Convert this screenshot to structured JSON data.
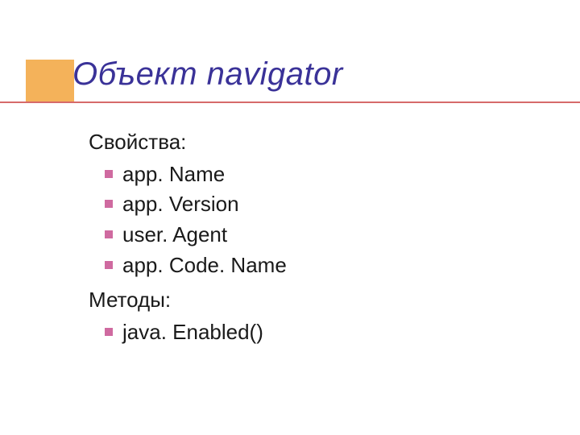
{
  "title": "Объект navigator",
  "sections": {
    "properties": {
      "label": "Свойства:",
      "items": [
        "app. Name",
        "app. Version",
        "user. Agent",
        "app. Code. Name"
      ]
    },
    "methods": {
      "label": "Методы:",
      "items": [
        "java. Enabled()"
      ]
    }
  },
  "colors": {
    "accent_block": "#f4b25a",
    "title": "#3a3298",
    "underline": "#d66a6a",
    "bullet": "#cf6aa0"
  }
}
